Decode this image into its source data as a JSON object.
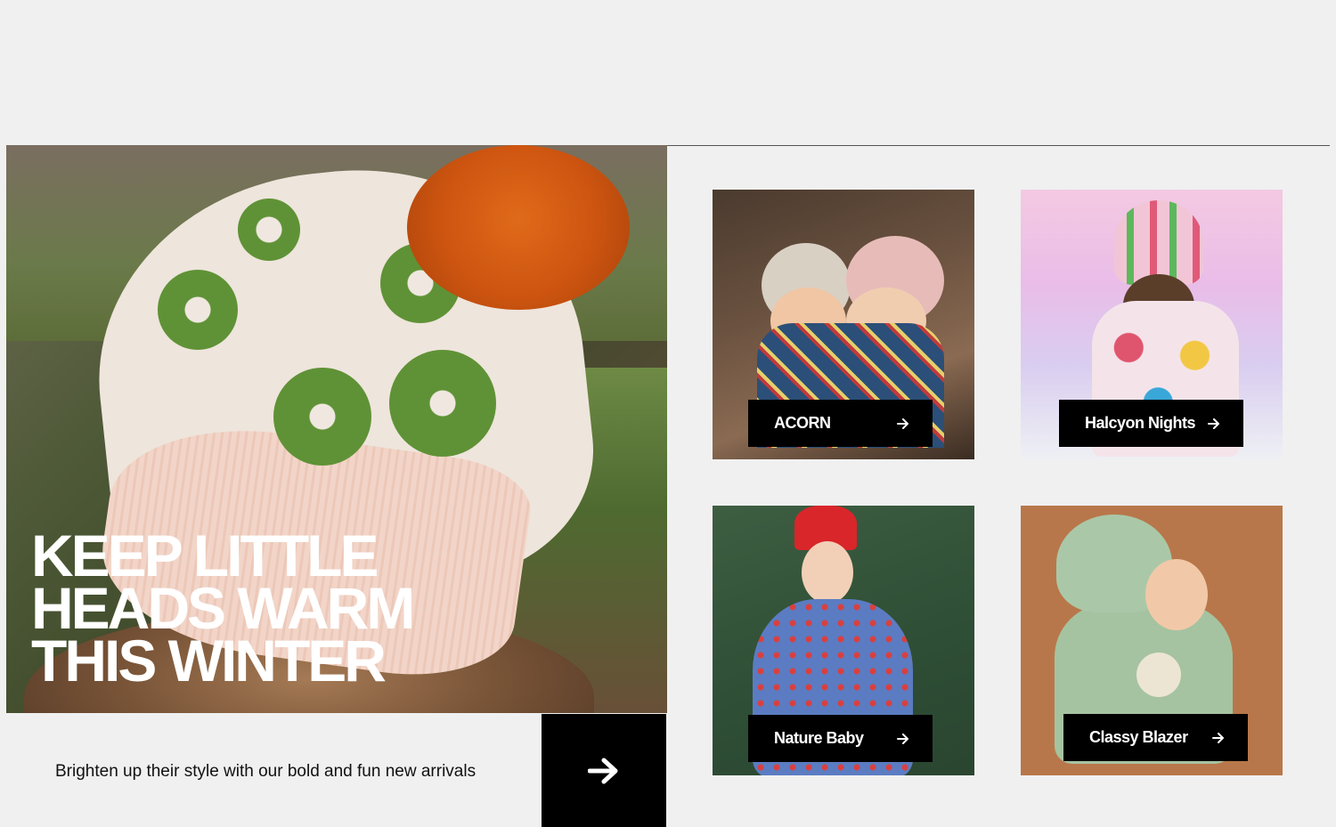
{
  "hero": {
    "title": "KEEP LITTLE\nHEADS WARM\nTHIS WINTER",
    "tagline": "Brighten up their style with our bold and fun new arrivals",
    "cta_icon": "arrow-right-icon"
  },
  "collections": [
    {
      "label": "ACORN",
      "icon": "arrow-right-icon"
    },
    {
      "label": "Halcyon Nights",
      "icon": "arrow-right-icon"
    },
    {
      "label": "Nature Baby",
      "icon": "arrow-right-icon"
    },
    {
      "label": "Classy Blazer",
      "icon": "arrow-right-icon"
    }
  ],
  "colors": {
    "page_bg": "#f0f0f0",
    "button_bg": "#000000",
    "button_text": "#ffffff"
  }
}
